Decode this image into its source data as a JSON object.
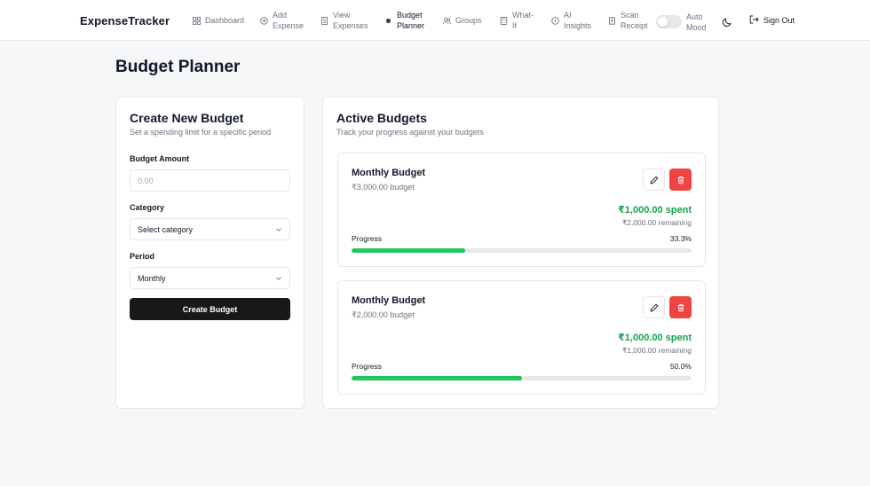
{
  "app": {
    "brand": "ExpenseTracker"
  },
  "nav": {
    "items": [
      {
        "label": "Dashboard",
        "icon": "dashboard-grid-icon"
      },
      {
        "label": "Add\nExpense",
        "icon": "plus-circle-icon"
      },
      {
        "label": "View\nExpenses",
        "icon": "list-icon"
      },
      {
        "label": "Budget\nPlanner",
        "icon": "dot-icon"
      },
      {
        "label": "Groups",
        "icon": "users-icon"
      },
      {
        "label": "What-\nIf",
        "icon": "calculator-icon"
      },
      {
        "label": "AI\nInsights",
        "icon": "info-circle-icon"
      },
      {
        "label": "Scan\nReceipt",
        "icon": "receipt-icon"
      }
    ],
    "active_index": 3,
    "auto_mood_label": "Auto\nMood",
    "auto_mood_on": false,
    "sign_out_label": "Sign Out"
  },
  "page": {
    "title": "Budget Planner"
  },
  "create": {
    "title": "Create New Budget",
    "subtitle": "Set a spending limit for a specific period",
    "amount_label": "Budget Amount",
    "amount_placeholder": "0.00",
    "category_label": "Category",
    "category_value": "Select category",
    "period_label": "Period",
    "period_value": "Monthly",
    "submit_label": "Create Budget"
  },
  "active": {
    "title": "Active Budgets",
    "subtitle": "Track your progress against your budgets",
    "progress_label": "Progress",
    "budgets": [
      {
        "name": "Monthly Budget",
        "budget_text": "₹3,000.00 budget",
        "spent_text": "₹1,000.00 spent",
        "remaining_text": "₹2,000.00 remaining",
        "percent_text": "33.3%",
        "progress": 0.333
      },
      {
        "name": "Monthly Budget",
        "budget_text": "₹2,000.00 budget",
        "spent_text": "₹1,000.00 spent",
        "remaining_text": "₹1,000.00 remaining",
        "percent_text": "50.0%",
        "progress": 0.5
      }
    ]
  },
  "colors": {
    "accent_dark": "#18181b",
    "danger": "#ef4444",
    "success": "#16a34a",
    "progress_fill": "#22c55e"
  }
}
